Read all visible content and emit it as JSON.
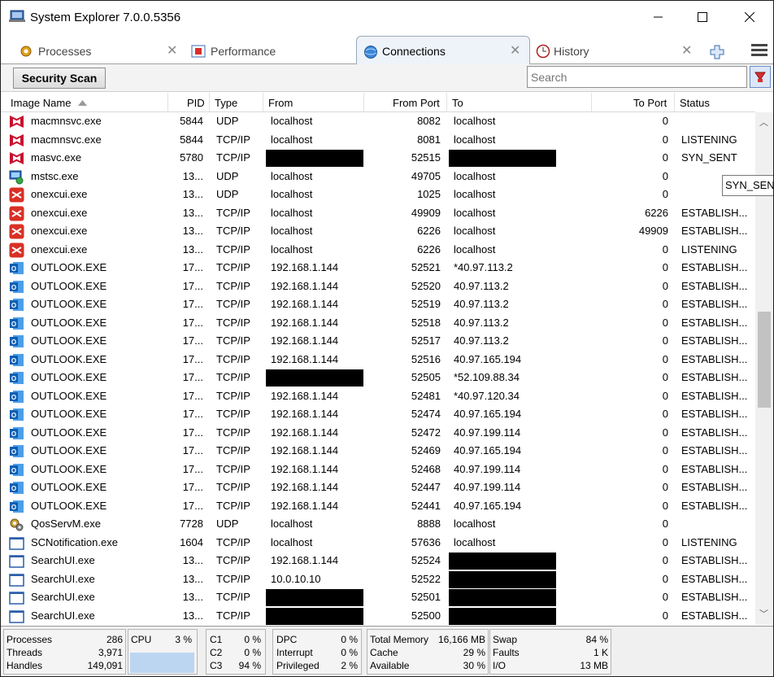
{
  "window": {
    "title": "System Explorer 7.0.0.5356"
  },
  "tabs": [
    {
      "label": "Processes",
      "icon": "gear-icon",
      "active": false
    },
    {
      "label": "Performance",
      "icon": "performance-icon",
      "active": false
    },
    {
      "label": "Connections",
      "icon": "globe-icon",
      "active": true
    },
    {
      "label": "History",
      "icon": "clock-icon",
      "active": false
    }
  ],
  "toolbar": {
    "security_scan_label": "Security Scan",
    "search_placeholder": "Search"
  },
  "columns": {
    "image_name": "Image Name",
    "pid": "PID",
    "type": "Type",
    "from": "From",
    "from_port": "From Port",
    "to": "To",
    "to_port": "To Port",
    "status": "Status"
  },
  "rows": [
    {
      "name": "macmnsvc.exe",
      "icon": "mcafee-icon",
      "pid": "5844",
      "type": "UDP",
      "from": "localhost",
      "from_port": "8082",
      "to": "localhost",
      "to_port": "0",
      "status": ""
    },
    {
      "name": "macmnsvc.exe",
      "icon": "mcafee-icon",
      "pid": "5844",
      "type": "TCP/IP",
      "from": "localhost",
      "from_port": "8081",
      "to": "localhost",
      "to_port": "0",
      "status": "LISTENING"
    },
    {
      "name": "masvc.exe",
      "icon": "mcafee-icon",
      "pid": "5780",
      "type": "TCP/IP",
      "from": "",
      "from_port": "52515",
      "to": "",
      "to_port": "0",
      "status": "SYN_SENT",
      "redact_from": true,
      "redact_to": true
    },
    {
      "name": "mstsc.exe",
      "icon": "remote-desktop-icon",
      "pid": "13...",
      "type": "UDP",
      "from": "localhost",
      "from_port": "49705",
      "to": "localhost",
      "to_port": "0",
      "status": ""
    },
    {
      "name": "onexcui.exe",
      "icon": "onex-icon",
      "pid": "13...",
      "type": "UDP",
      "from": "localhost",
      "from_port": "1025",
      "to": "localhost",
      "to_port": "0",
      "status": ""
    },
    {
      "name": "onexcui.exe",
      "icon": "onex-icon",
      "pid": "13...",
      "type": "TCP/IP",
      "from": "localhost",
      "from_port": "49909",
      "to": "localhost",
      "to_port": "6226",
      "status": "ESTABLISH..."
    },
    {
      "name": "onexcui.exe",
      "icon": "onex-icon",
      "pid": "13...",
      "type": "TCP/IP",
      "from": "localhost",
      "from_port": "6226",
      "to": "localhost",
      "to_port": "49909",
      "status": "ESTABLISH..."
    },
    {
      "name": "onexcui.exe",
      "icon": "onex-icon",
      "pid": "13...",
      "type": "TCP/IP",
      "from": "localhost",
      "from_port": "6226",
      "to": "localhost",
      "to_port": "0",
      "status": "LISTENING"
    },
    {
      "name": "OUTLOOK.EXE",
      "icon": "outlook-icon",
      "pid": "17...",
      "type": "TCP/IP",
      "from": "192.168.1.144",
      "from_port": "52521",
      "to": "*40.97.113.2",
      "to_port": "0",
      "status": "ESTABLISH..."
    },
    {
      "name": "OUTLOOK.EXE",
      "icon": "outlook-icon",
      "pid": "17...",
      "type": "TCP/IP",
      "from": "192.168.1.144",
      "from_port": "52520",
      "to": "40.97.113.2",
      "to_port": "0",
      "status": "ESTABLISH..."
    },
    {
      "name": "OUTLOOK.EXE",
      "icon": "outlook-icon",
      "pid": "17...",
      "type": "TCP/IP",
      "from": "192.168.1.144",
      "from_port": "52519",
      "to": "40.97.113.2",
      "to_port": "0",
      "status": "ESTABLISH..."
    },
    {
      "name": "OUTLOOK.EXE",
      "icon": "outlook-icon",
      "pid": "17...",
      "type": "TCP/IP",
      "from": "192.168.1.144",
      "from_port": "52518",
      "to": "40.97.113.2",
      "to_port": "0",
      "status": "ESTABLISH..."
    },
    {
      "name": "OUTLOOK.EXE",
      "icon": "outlook-icon",
      "pid": "17...",
      "type": "TCP/IP",
      "from": "192.168.1.144",
      "from_port": "52517",
      "to": "40.97.113.2",
      "to_port": "0",
      "status": "ESTABLISH..."
    },
    {
      "name": "OUTLOOK.EXE",
      "icon": "outlook-icon",
      "pid": "17...",
      "type": "TCP/IP",
      "from": "192.168.1.144",
      "from_port": "52516",
      "to": "40.97.165.194",
      "to_port": "0",
      "status": "ESTABLISH..."
    },
    {
      "name": "OUTLOOK.EXE",
      "icon": "outlook-icon",
      "pid": "17...",
      "type": "TCP/IP",
      "from": "",
      "from_port": "52505",
      "to": "*52.109.88.34",
      "to_port": "0",
      "status": "ESTABLISH...",
      "redact_from": true
    },
    {
      "name": "OUTLOOK.EXE",
      "icon": "outlook-icon",
      "pid": "17...",
      "type": "TCP/IP",
      "from": "192.168.1.144",
      "from_port": "52481",
      "to": "*40.97.120.34",
      "to_port": "0",
      "status": "ESTABLISH..."
    },
    {
      "name": "OUTLOOK.EXE",
      "icon": "outlook-icon",
      "pid": "17...",
      "type": "TCP/IP",
      "from": "192.168.1.144",
      "from_port": "52474",
      "to": "40.97.165.194",
      "to_port": "0",
      "status": "ESTABLISH..."
    },
    {
      "name": "OUTLOOK.EXE",
      "icon": "outlook-icon",
      "pid": "17...",
      "type": "TCP/IP",
      "from": "192.168.1.144",
      "from_port": "52472",
      "to": "40.97.199.114",
      "to_port": "0",
      "status": "ESTABLISH..."
    },
    {
      "name": "OUTLOOK.EXE",
      "icon": "outlook-icon",
      "pid": "17...",
      "type": "TCP/IP",
      "from": "192.168.1.144",
      "from_port": "52469",
      "to": "40.97.165.194",
      "to_port": "0",
      "status": "ESTABLISH..."
    },
    {
      "name": "OUTLOOK.EXE",
      "icon": "outlook-icon",
      "pid": "17...",
      "type": "TCP/IP",
      "from": "192.168.1.144",
      "from_port": "52468",
      "to": "40.97.199.114",
      "to_port": "0",
      "status": "ESTABLISH..."
    },
    {
      "name": "OUTLOOK.EXE",
      "icon": "outlook-icon",
      "pid": "17...",
      "type": "TCP/IP",
      "from": "192.168.1.144",
      "from_port": "52447",
      "to": "40.97.199.114",
      "to_port": "0",
      "status": "ESTABLISH..."
    },
    {
      "name": "OUTLOOK.EXE",
      "icon": "outlook-icon",
      "pid": "17...",
      "type": "TCP/IP",
      "from": "192.168.1.144",
      "from_port": "52441",
      "to": "40.97.165.194",
      "to_port": "0",
      "status": "ESTABLISH..."
    },
    {
      "name": "QosServM.exe",
      "icon": "gears-icon",
      "pid": "7728",
      "type": "UDP",
      "from": "localhost",
      "from_port": "8888",
      "to": "localhost",
      "to_port": "0",
      "status": ""
    },
    {
      "name": "SCNotification.exe",
      "icon": "window-icon",
      "pid": "1604",
      "type": "TCP/IP",
      "from": "localhost",
      "from_port": "57636",
      "to": "localhost",
      "to_port": "0",
      "status": "LISTENING"
    },
    {
      "name": "SearchUI.exe",
      "icon": "window-icon",
      "pid": "13...",
      "type": "TCP/IP",
      "from": "192.168.1.144",
      "from_port": "52524",
      "to": "",
      "to_port": "0",
      "status": "ESTABLISH...",
      "redact_to": true
    },
    {
      "name": "SearchUI.exe",
      "icon": "window-icon",
      "pid": "13...",
      "type": "TCP/IP",
      "from": "10.0.10.10",
      "from_port": "52522",
      "to": "",
      "to_port": "0",
      "status": "ESTABLISH...",
      "redact_to": true
    },
    {
      "name": "SearchUI.exe",
      "icon": "window-icon",
      "pid": "13...",
      "type": "TCP/IP",
      "from": "",
      "from_port": "52501",
      "to": "",
      "to_port": "0",
      "status": "ESTABLISH...",
      "redact_from": true,
      "redact_to": true
    },
    {
      "name": "SearchUI.exe",
      "icon": "window-icon",
      "pid": "13...",
      "type": "TCP/IP",
      "from": "",
      "from_port": "52500",
      "to": "",
      "to_port": "0",
      "status": "ESTABLISH...",
      "redact_from": true,
      "redact_to": true
    }
  ],
  "tooltip": "SYN_SENT",
  "status": {
    "processes_label": "Processes",
    "processes_value": "286",
    "threads_label": "Threads",
    "threads_value": "3,971",
    "handles_label": "Handles",
    "handles_value": "149,091",
    "cpu_label": "CPU",
    "cpu_value": "3 %",
    "c1_label": "C1",
    "c1_value": "0 %",
    "c2_label": "C2",
    "c2_value": "0 %",
    "c3_label": "C3",
    "c3_value": "94 %",
    "dpc_label": "DPC",
    "dpc_value": "0 %",
    "interrupt_label": "Interrupt",
    "interrupt_value": "0 %",
    "privileged_label": "Privileged",
    "privileged_value": "2 %",
    "total_memory_label": "Total Memory",
    "total_memory_value": "16,166 MB",
    "cache_label": "Cache",
    "cache_value": "29 %",
    "available_label": "Available",
    "available_value": "30 %",
    "swap_label": "Swap",
    "swap_value": "84 %",
    "faults_label": "Faults",
    "faults_value": "1 K",
    "io_label": "I/O",
    "io_value": "13 MB"
  }
}
